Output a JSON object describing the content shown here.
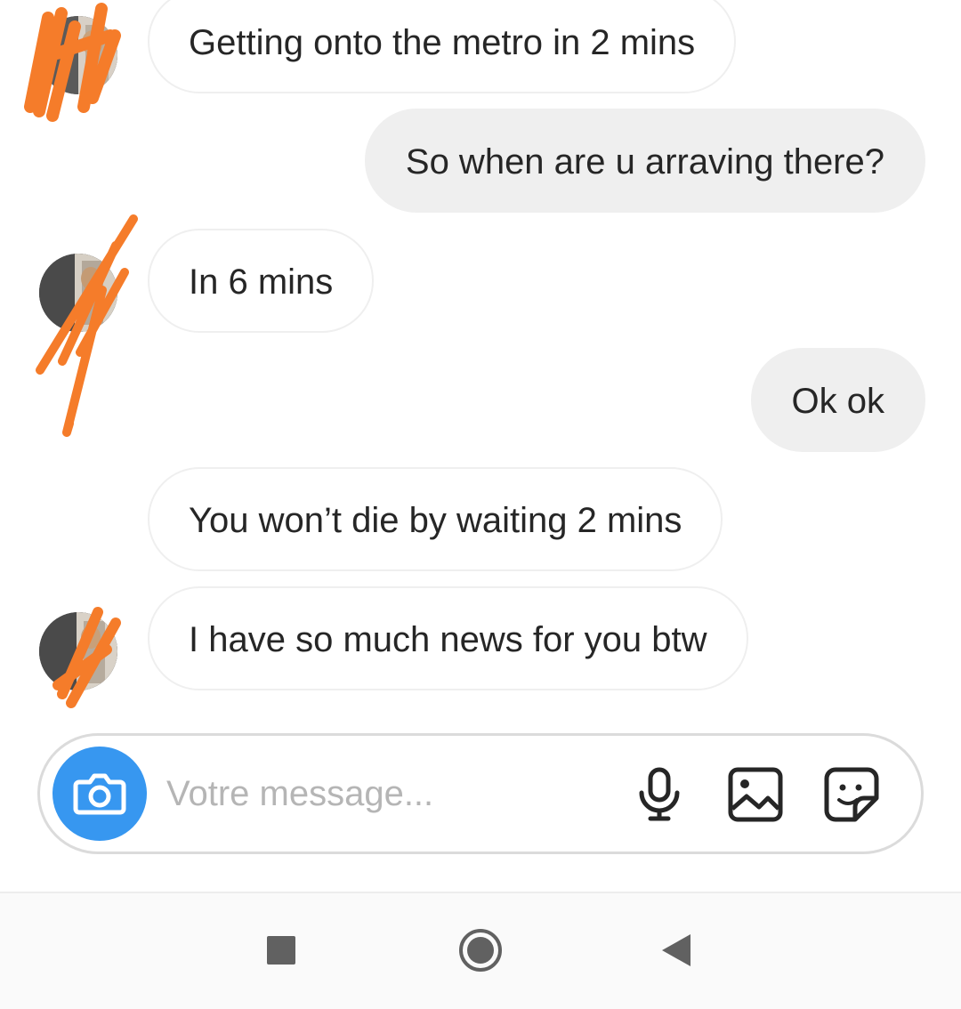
{
  "thread": {
    "messages": [
      {
        "sender": "them",
        "text": "Getting onto the metro in 2 mins",
        "has_avatar": true
      },
      {
        "sender": "me",
        "text": "So when are u arraving there?"
      },
      {
        "sender": "them",
        "text": "In 6 mins",
        "has_avatar": true
      },
      {
        "sender": "me",
        "text": "Ok ok"
      },
      {
        "sender": "them",
        "text": "You won’t die by waiting 2 mins",
        "has_avatar": false
      },
      {
        "sender": "them",
        "text": "I have so much news for you btw",
        "has_avatar": true
      }
    ]
  },
  "composer": {
    "placeholder": "Votre message...",
    "value": "",
    "icons": [
      "camera-icon",
      "microphone-icon",
      "gallery-icon",
      "sticker-icon"
    ]
  },
  "navbar": {
    "icons": [
      "recents-square-icon",
      "home-circle-icon",
      "back-triangle-icon"
    ]
  },
  "colors": {
    "outgoing_bubble": "#efefef",
    "incoming_border": "#efefef",
    "camera_button": "#3797f0",
    "redaction_scribble": "#f57c2a",
    "text": "#262626",
    "placeholder": "#b5b5b5"
  }
}
